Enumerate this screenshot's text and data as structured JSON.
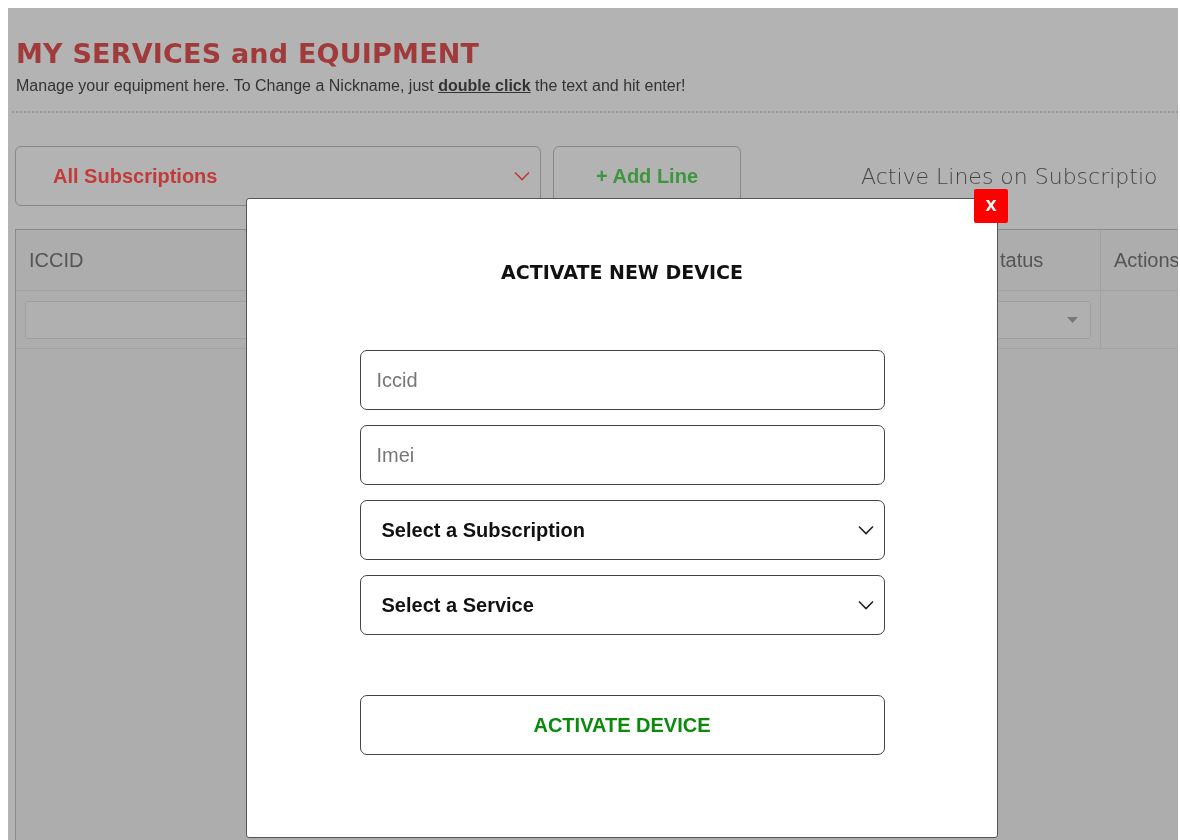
{
  "page": {
    "title": "MY SERVICES and EQUIPMENT",
    "subtitle": "Manage your equipment here. To Change a Nickname, just **double click** the text and hit enter!"
  },
  "toolbar": {
    "subscription_filter": "All Subscriptions",
    "add_button": "+ Add Line",
    "active_lines_label": "Active Lines on Subscriptio"
  },
  "table": {
    "columns": [
      {
        "label": "ICCID",
        "kind": "text"
      },
      {
        "label": "tatus",
        "kind": "select"
      },
      {
        "label": "Actions",
        "kind": "none"
      }
    ]
  },
  "dialog": {
    "title": "ACTIVATE NEW DEVICE",
    "close": "x",
    "fields": [
      {
        "kind": "text",
        "placeholder": "Iccid"
      },
      {
        "kind": "text",
        "placeholder": "Imei"
      },
      {
        "kind": "select",
        "value": "Select a Subscription"
      },
      {
        "kind": "select",
        "value": "Select a Service"
      }
    ],
    "submit": "ACTIVATE DEVICE"
  }
}
